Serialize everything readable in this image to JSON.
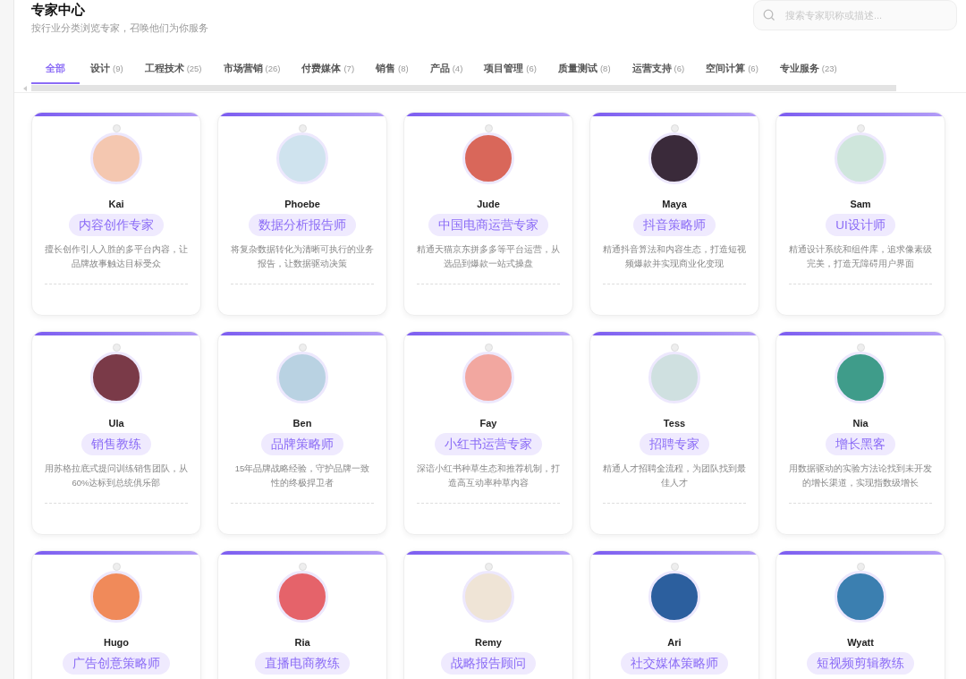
{
  "header": {
    "title": "专家中心",
    "subtitle": "按行业分类浏览专家，召唤他们为你服务"
  },
  "search": {
    "placeholder": "搜索专家职称或描述..."
  },
  "tabs": [
    {
      "label": "全部",
      "selected": true
    },
    {
      "label": "设计",
      "count": "(9)",
      "selected": false
    },
    {
      "label": "工程技术",
      "count": "(25)",
      "selected": false
    },
    {
      "label": "市场营销",
      "count": "(26)",
      "selected": false
    },
    {
      "label": "付费媒体",
      "count": "(7)",
      "selected": false
    },
    {
      "label": "销售",
      "count": "(8)",
      "selected": false
    },
    {
      "label": "产品",
      "count": "(4)",
      "selected": false
    },
    {
      "label": "项目管理",
      "count": "(6)",
      "selected": false
    },
    {
      "label": "质量测试",
      "count": "(8)",
      "selected": false
    },
    {
      "label": "运营支持",
      "count": "(6)",
      "selected": false
    },
    {
      "label": "空间计算",
      "count": "(6)",
      "selected": false
    },
    {
      "label": "专业服务",
      "count": "(23)",
      "selected": false
    }
  ],
  "experts": [
    {
      "name": "Kai",
      "role": "内容创作专家",
      "description": "擅长创作引人入胜的多平台内容，让品牌故事触达目标受众",
      "color": "#f4c7b0"
    },
    {
      "name": "Phoebe",
      "role": "数据分析报告师",
      "description": "将复杂数据转化为清晰可执行的业务报告，让数据驱动决策",
      "color": "#cfe3ee"
    },
    {
      "name": "Jude",
      "role": "中国电商运营专家",
      "description": "精通天猫京东拼多多等平台运营，从选品到爆款一站式操盘",
      "color": "#d9675a"
    },
    {
      "name": "Maya",
      "role": "抖音策略师",
      "description": "精通抖音算法和内容生态，打造短视频爆款并实现商业化变现",
      "color": "#3a2a3a"
    },
    {
      "name": "Sam",
      "role": "UI设计师",
      "description": "精通设计系统和组件库，追求像素级完美，打造无障碍用户界面",
      "color": "#cfe6dc"
    },
    {
      "name": "Ula",
      "role": "销售教练",
      "description": "用苏格拉底式提问训练销售团队，从60%达标到总统俱乐部",
      "color": "#7a3a48"
    },
    {
      "name": "Ben",
      "role": "品牌策略师",
      "description": "15年品牌战略经验，守护品牌一致性的终极捍卫者",
      "color": "#b9d2e2"
    },
    {
      "name": "Fay",
      "role": "小红书运营专家",
      "description": "深谙小红书种草生态和推荐机制，打造高互动率种草内容",
      "color": "#f2a7a0"
    },
    {
      "name": "Tess",
      "role": "招聘专家",
      "description": "精通人才招聘全流程，为团队找到最佳人才",
      "color": "#cfe0e0"
    },
    {
      "name": "Nia",
      "role": "增长黑客",
      "description": "用数据驱动的实验方法论找到未开发的增长渠道，实现指数级增长",
      "color": "#3f9c8a"
    },
    {
      "name": "Hugo",
      "role": "广告创意策略师",
      "color": "#f08a5a"
    },
    {
      "name": "Ria",
      "role": "直播电商教练",
      "color": "#e5636a"
    },
    {
      "name": "Remy",
      "role": "战略报告顾问",
      "color": "#efe4d6"
    },
    {
      "name": "Ari",
      "role": "社交媒体策略师",
      "color": "#2c5f9e"
    },
    {
      "name": "Wyatt",
      "role": "短视频剪辑教练",
      "color": "#3b7fb0"
    }
  ]
}
